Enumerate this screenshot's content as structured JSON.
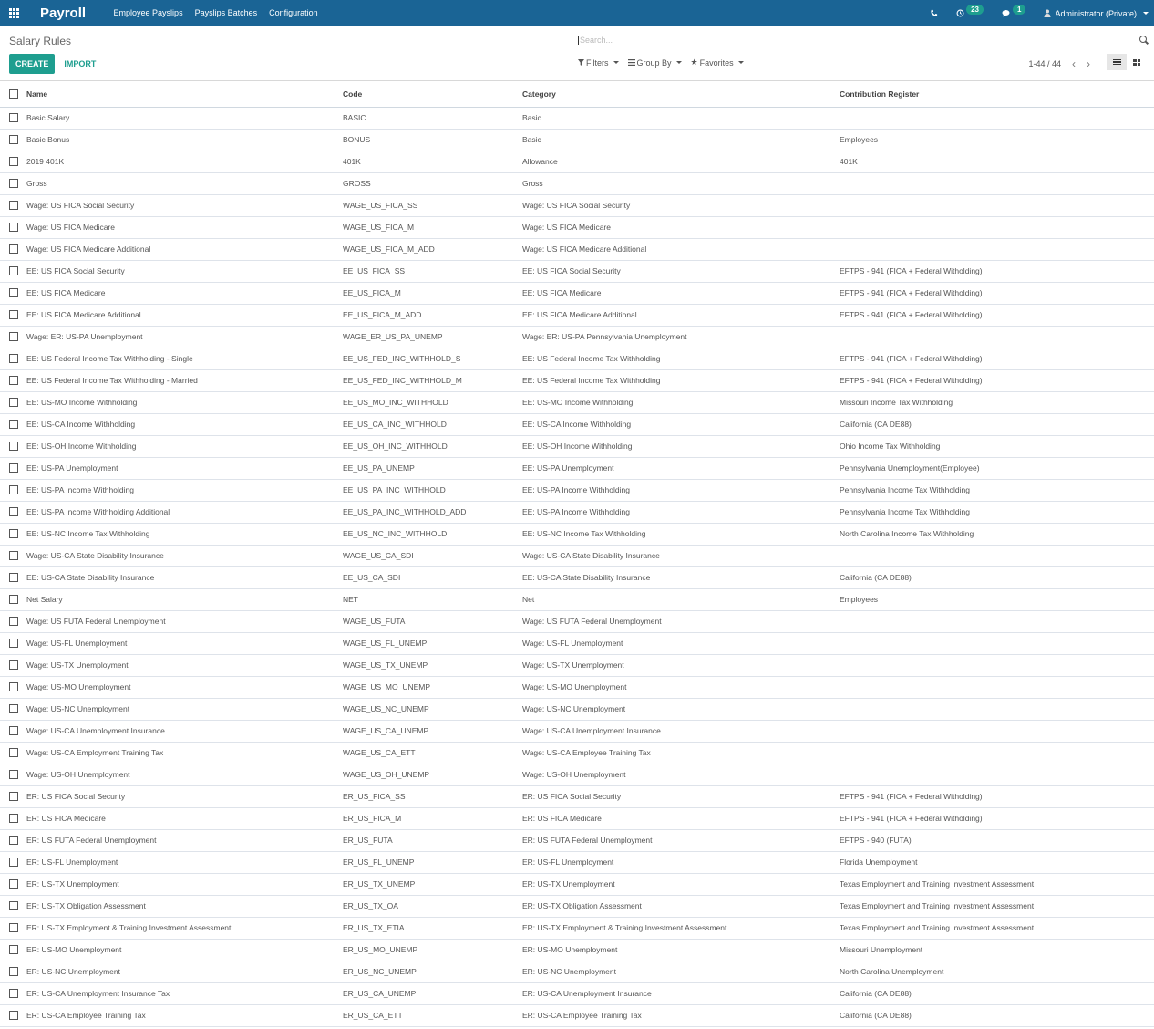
{
  "navbar": {
    "app_name": "Payroll",
    "menu": [
      "Employee Payslips",
      "Payslips Batches",
      "Configuration"
    ],
    "activity_count": "23",
    "messages_count": "1",
    "user": "Administrator (Private)",
    "icons": {
      "apps": "grid-icon",
      "phone": "phone-icon",
      "activity": "clock-icon",
      "messages": "chat-icon",
      "user": "user-icon"
    }
  },
  "control_panel": {
    "breadcrumb": "Salary Rules",
    "create_label": "CREATE",
    "import_label": "IMPORT",
    "search_placeholder": "Search...",
    "filters_label": "Filters",
    "groupby_label": "Group By",
    "favorites_label": "Favorites",
    "pager": "1-44 / 44"
  },
  "colors": {
    "navbar": "#1a6495",
    "accent": "#1e9e8f"
  },
  "table": {
    "columns": [
      "Name",
      "Code",
      "Category",
      "Contribution Register"
    ],
    "rows": [
      [
        "Basic Salary",
        "BASIC",
        "Basic",
        ""
      ],
      [
        "Basic Bonus",
        "BONUS",
        "Basic",
        "Employees"
      ],
      [
        "2019 401K",
        "401K",
        "Allowance",
        "401K"
      ],
      [
        "Gross",
        "GROSS",
        "Gross",
        ""
      ],
      [
        "Wage: US FICA Social Security",
        "WAGE_US_FICA_SS",
        "Wage: US FICA Social Security",
        ""
      ],
      [
        "Wage: US FICA Medicare",
        "WAGE_US_FICA_M",
        "Wage: US FICA Medicare",
        ""
      ],
      [
        "Wage: US FICA Medicare Additional",
        "WAGE_US_FICA_M_ADD",
        "Wage: US FICA Medicare Additional",
        ""
      ],
      [
        "EE: US FICA Social Security",
        "EE_US_FICA_SS",
        "EE: US FICA Social Security",
        "EFTPS - 941 (FICA + Federal Witholding)"
      ],
      [
        "EE: US FICA Medicare",
        "EE_US_FICA_M",
        "EE: US FICA Medicare",
        "EFTPS - 941 (FICA + Federal Witholding)"
      ],
      [
        "EE: US FICA Medicare Additional",
        "EE_US_FICA_M_ADD",
        "EE: US FICA Medicare Additional",
        "EFTPS - 941 (FICA + Federal Witholding)"
      ],
      [
        "Wage: ER: US-PA Unemployment",
        "WAGE_ER_US_PA_UNEMP",
        "Wage: ER: US-PA Pennsylvania Unemployment",
        ""
      ],
      [
        "EE: US Federal Income Tax Withholding - Single",
        "EE_US_FED_INC_WITHHOLD_S",
        "EE: US Federal Income Tax Withholding",
        "EFTPS - 941 (FICA + Federal Witholding)"
      ],
      [
        "EE: US Federal Income Tax Withholding - Married",
        "EE_US_FED_INC_WITHHOLD_M",
        "EE: US Federal Income Tax Withholding",
        "EFTPS - 941 (FICA + Federal Witholding)"
      ],
      [
        "EE: US-MO Income Withholding",
        "EE_US_MO_INC_WITHHOLD",
        "EE: US-MO Income Withholding",
        "Missouri Income Tax Withholding"
      ],
      [
        "EE: US-CA Income Withholding",
        "EE_US_CA_INC_WITHHOLD",
        "EE: US-CA Income Withholding",
        "California (CA DE88)"
      ],
      [
        "EE: US-OH Income Withholding",
        "EE_US_OH_INC_WITHHOLD",
        "EE: US-OH Income Withholding",
        "Ohio Income Tax Withholding"
      ],
      [
        "EE: US-PA Unemployment",
        "EE_US_PA_UNEMP",
        "EE: US-PA Unemployment",
        "Pennsylvania Unemployment(Employee)"
      ],
      [
        "EE: US-PA Income Withholding",
        "EE_US_PA_INC_WITHHOLD",
        "EE: US-PA Income Withholding",
        "Pennsylvania Income Tax Withholding"
      ],
      [
        "EE: US-PA Income Withholding Additional",
        "EE_US_PA_INC_WITHHOLD_ADD",
        "EE: US-PA Income Withholding",
        "Pennsylvania Income Tax Withholding"
      ],
      [
        "EE: US-NC Income Tax Withholding",
        "EE_US_NC_INC_WITHHOLD",
        "EE: US-NC Income Tax Withholding",
        "North Carolina Income Tax Withholding"
      ],
      [
        "Wage: US-CA State Disability Insurance",
        "WAGE_US_CA_SDI",
        "Wage: US-CA State Disability Insurance",
        ""
      ],
      [
        "EE: US-CA State Disability Insurance",
        "EE_US_CA_SDI",
        "EE: US-CA State Disability Insurance",
        "California (CA DE88)"
      ],
      [
        "Net Salary",
        "NET",
        "Net",
        "Employees"
      ],
      [
        "Wage: US FUTA Federal Unemployment",
        "WAGE_US_FUTA",
        "Wage: US FUTA Federal Unemployment",
        ""
      ],
      [
        "Wage: US-FL Unemployment",
        "WAGE_US_FL_UNEMP",
        "Wage: US-FL Unemployment",
        ""
      ],
      [
        "Wage: US-TX Unemployment",
        "WAGE_US_TX_UNEMP",
        "Wage: US-TX Unemployment",
        ""
      ],
      [
        "Wage: US-MO Unemployment",
        "WAGE_US_MO_UNEMP",
        "Wage: US-MO Unemployment",
        ""
      ],
      [
        "Wage: US-NC Unemployment",
        "WAGE_US_NC_UNEMP",
        "Wage: US-NC Unemployment",
        ""
      ],
      [
        "Wage: US-CA Unemployment Insurance",
        "WAGE_US_CA_UNEMP",
        "Wage: US-CA Unemployment Insurance",
        ""
      ],
      [
        "Wage: US-CA Employment Training Tax",
        "WAGE_US_CA_ETT",
        "Wage: US-CA Employee Training Tax",
        ""
      ],
      [
        "Wage: US-OH Unemployment",
        "WAGE_US_OH_UNEMP",
        "Wage: US-OH Unemployment",
        ""
      ],
      [
        "ER: US FICA Social Security",
        "ER_US_FICA_SS",
        "ER: US FICA Social Security",
        "EFTPS - 941 (FICA + Federal Witholding)"
      ],
      [
        "ER: US FICA Medicare",
        "ER_US_FICA_M",
        "ER: US FICA Medicare",
        "EFTPS - 941 (FICA + Federal Witholding)"
      ],
      [
        "ER: US FUTA Federal Unemployment",
        "ER_US_FUTA",
        "ER: US FUTA Federal Unemployment",
        "EFTPS - 940 (FUTA)"
      ],
      [
        "ER: US-FL Unemployment",
        "ER_US_FL_UNEMP",
        "ER: US-FL Unemployment",
        "Florida Unemployment"
      ],
      [
        "ER: US-TX Unemployment",
        "ER_US_TX_UNEMP",
        "ER: US-TX Unemployment",
        "Texas Employment and Training Investment Assessment"
      ],
      [
        "ER: US-TX Obligation Assessment",
        "ER_US_TX_OA",
        "ER: US-TX Obligation Assessment",
        "Texas Employment and Training Investment Assessment"
      ],
      [
        "ER: US-TX Employment & Training Investment Assessment",
        "ER_US_TX_ETIA",
        "ER: US-TX Employment & Training Investment Assessment",
        "Texas Employment and Training Investment Assessment"
      ],
      [
        "ER: US-MO Unemployment",
        "ER_US_MO_UNEMP",
        "ER: US-MO Unemployment",
        "Missouri Unemployment"
      ],
      [
        "ER: US-NC Unemployment",
        "ER_US_NC_UNEMP",
        "ER: US-NC Unemployment",
        "North Carolina Unemployment"
      ],
      [
        "ER: US-CA Unemployment Insurance Tax",
        "ER_US_CA_UNEMP",
        "ER: US-CA Unemployment Insurance",
        "California (CA DE88)"
      ],
      [
        "ER: US-CA Employee Training Tax",
        "ER_US_CA_ETT",
        "ER: US-CA Employee Training Tax",
        "California (CA DE88)"
      ]
    ]
  }
}
